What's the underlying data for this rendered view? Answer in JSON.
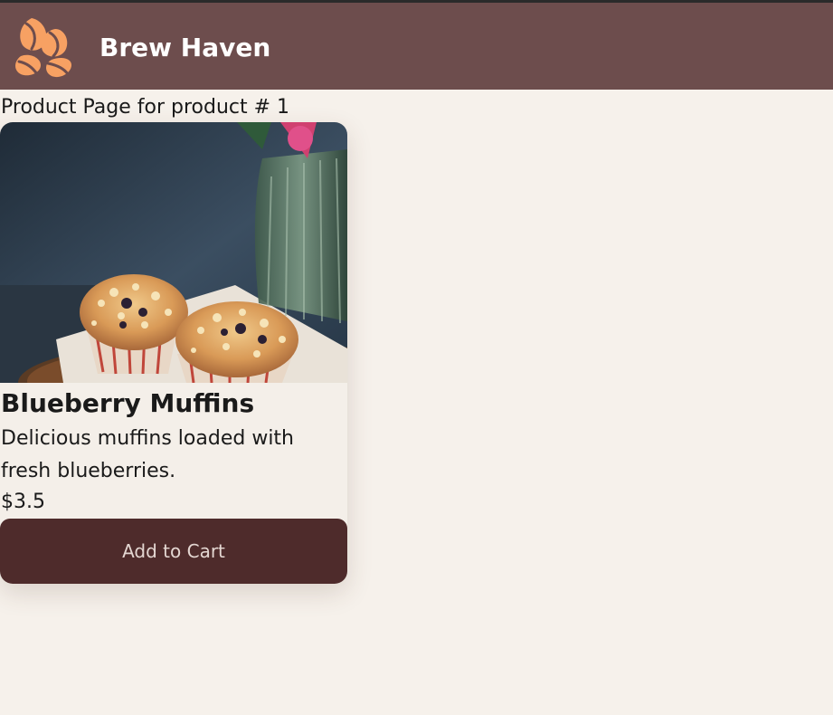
{
  "header": {
    "brand": "Brew Haven",
    "logo_icon": "coffee-beans-icon",
    "background": "#6d4d4d",
    "logo_color": "#f7a163"
  },
  "page": {
    "heading": "Product Page for product # 1"
  },
  "product": {
    "image_icon": "blueberry-muffins-photo",
    "name": "Blueberry Muffins",
    "description": "Delicious muffins loaded with fresh blueberries.",
    "price": "$3.5",
    "button_label": "Add to Cart",
    "button_color": "#4e2b2b"
  }
}
